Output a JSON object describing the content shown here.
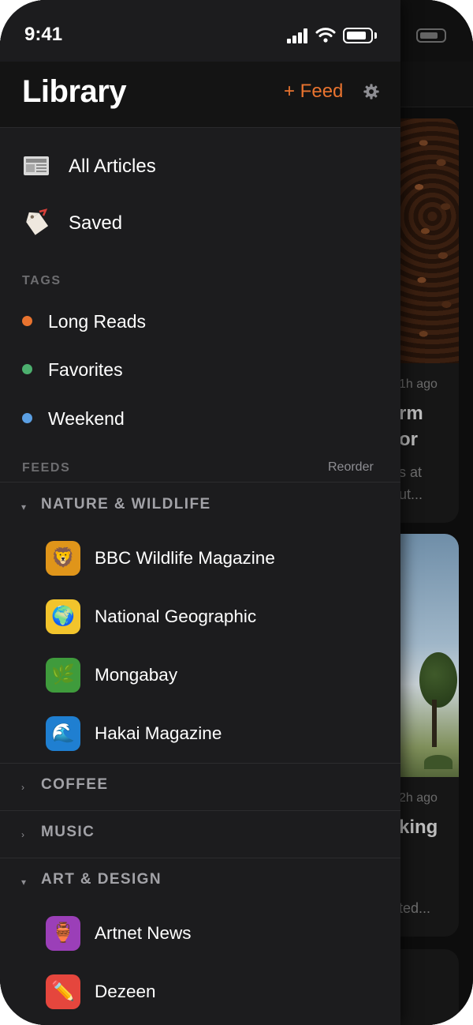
{
  "status_bar": {
    "time": "9:41"
  },
  "header": {
    "title": "Library",
    "add_feed_label": "+ Feed",
    "settings_icon": "gear-icon"
  },
  "colors": {
    "accent": "#e8732f",
    "drawer_bg": "#1c1c1e",
    "tag_long_reads": "#e8732f",
    "tag_favorites": "#4caf6e",
    "tag_weekend": "#5b9fe3"
  },
  "nav": [
    {
      "label": "All Articles",
      "icon": "newspaper-icon"
    },
    {
      "label": "Saved",
      "icon": "bookmark-tag-icon"
    }
  ],
  "tags_section": {
    "title": "TAGS",
    "items": [
      {
        "label": "Long Reads",
        "color": "#e8732f"
      },
      {
        "label": "Favorites",
        "color": "#4caf6e"
      },
      {
        "label": "Weekend",
        "color": "#5b9fe3"
      }
    ]
  },
  "feeds_section": {
    "title": "FEEDS",
    "reorder_label": "Reorder",
    "groups": [
      {
        "label": "NATURE & WILDLIFE",
        "chevron": "▾",
        "expanded": true,
        "feeds": [
          {
            "label": "BBC Wildlife Magazine",
            "icon": "lion-icon",
            "glyph": "🦁",
            "color": "#e0951a"
          },
          {
            "label": "National Geographic",
            "icon": "globe-icon",
            "glyph": "🌍",
            "color": "#f2c42c"
          },
          {
            "label": "Mongabay",
            "icon": "leaf-icon",
            "glyph": "🌿",
            "color": "#3f9b3c"
          },
          {
            "label": "Hakai Magazine",
            "icon": "wave-icon",
            "glyph": "🌊",
            "color": "#1f7fd1"
          }
        ]
      },
      {
        "label": "COFFEE",
        "chevron": "›",
        "expanded": false,
        "feeds": []
      },
      {
        "label": "MUSIC",
        "chevron": "›",
        "expanded": false,
        "feeds": []
      },
      {
        "label": "ART & DESIGN",
        "chevron": "▾",
        "expanded": true,
        "feeds": [
          {
            "label": "Artnet News",
            "icon": "vase-icon",
            "glyph": "🏺",
            "color": "#9b3fb8"
          },
          {
            "label": "Dezeen",
            "icon": "pencil-icon",
            "glyph": "✏️",
            "color": "#e5463d"
          }
        ]
      }
    ]
  },
  "background_feed": {
    "card1": {
      "time": "1h ago",
      "title_line1": "rm",
      "title_line2": "or",
      "sub_line1": "s at",
      "sub_line2": "ut..."
    },
    "card2": {
      "time": "2h ago",
      "title_line1": "king",
      "sub_line1": "ted..."
    }
  }
}
